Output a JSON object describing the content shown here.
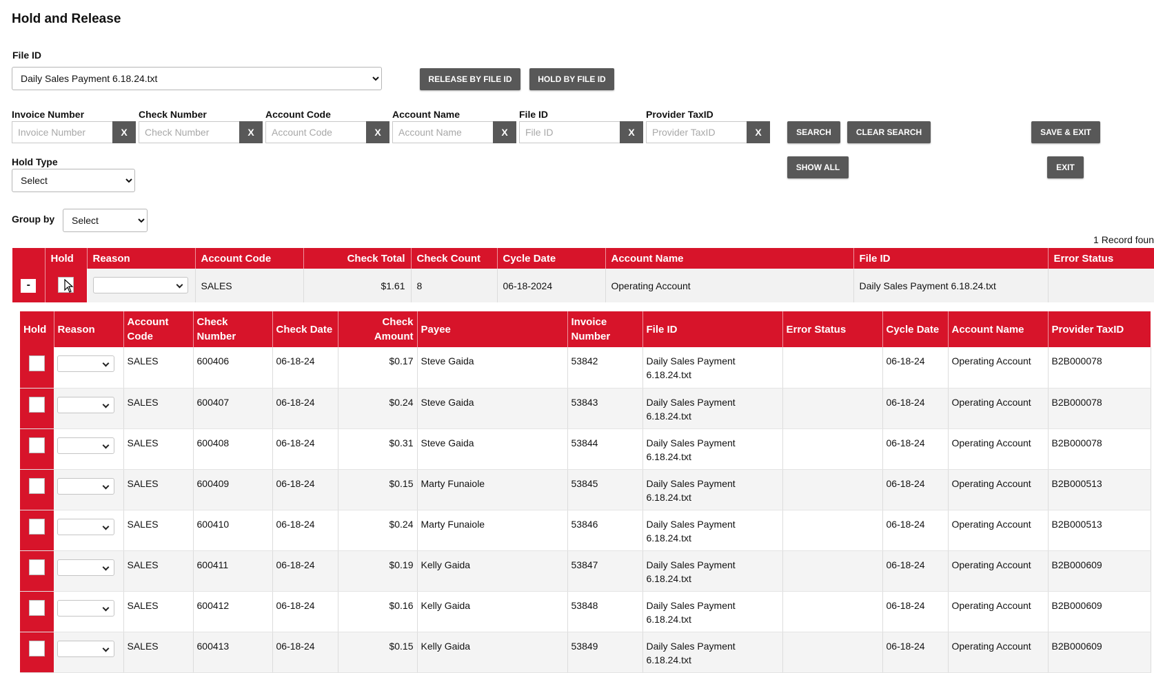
{
  "page": {
    "title": "Hold and Release"
  },
  "file_id_field": {
    "label": "File ID",
    "selected": "Daily Sales Payment 6.18.24.txt"
  },
  "buttons": {
    "release_by_file_id": "RELEASE BY FILE ID",
    "hold_by_file_id": "HOLD BY FILE ID",
    "search": "SEARCH",
    "clear_search": "CLEAR SEARCH",
    "save_exit": "SAVE & EXIT",
    "show_all": "SHOW ALL",
    "exit": "EXIT",
    "clear_x": "X",
    "collapse": "-"
  },
  "filters": [
    {
      "label": "Invoice Number",
      "placeholder": "Invoice Number",
      "value": ""
    },
    {
      "label": "Check Number",
      "placeholder": "Check Number",
      "value": ""
    },
    {
      "label": "Account Code",
      "placeholder": "Account Code",
      "value": ""
    },
    {
      "label": "Account Name",
      "placeholder": "Account Name",
      "value": ""
    },
    {
      "label": "File ID",
      "placeholder": "File ID",
      "value": ""
    },
    {
      "label": "Provider TaxID",
      "placeholder": "Provider TaxID",
      "value": ""
    }
  ],
  "hold_type": {
    "label": "Hold Type",
    "selected": "Select"
  },
  "group_by": {
    "label": "Group by",
    "selected": "Select"
  },
  "record_count": "1 Record foun",
  "group_table": {
    "headers": [
      "",
      "Hold",
      "Reason",
      "Account Code",
      "Check Total",
      "Check Count",
      "Cycle Date",
      "Account Name",
      "File ID",
      "Error Status"
    ],
    "row": {
      "account_code": "SALES",
      "check_total": "$1.61",
      "check_count": "8",
      "cycle_date": "06-18-2024",
      "account_name": "Operating Account",
      "file_id": "Daily Sales Payment 6.18.24.txt",
      "error_status": ""
    }
  },
  "detail_table": {
    "headers": {
      "hold": "Hold",
      "reason": "Reason",
      "account_code_1": "Account",
      "account_code_2": "Code",
      "check_number_1": "Check",
      "check_number_2": "Number",
      "check_date": "Check Date",
      "check_amount_1": "Check",
      "check_amount_2": "Amount",
      "payee": "Payee",
      "invoice_number_1": "Invoice",
      "invoice_number_2": "Number",
      "file_id": "File ID",
      "error_status": "Error Status",
      "cycle_date": "Cycle Date",
      "account_name": "Account Name",
      "provider_taxid": "Provider TaxID"
    },
    "rows": [
      {
        "account_code": "SALES",
        "check_number": "600406",
        "check_date": "06-18-24",
        "check_amount": "$0.17",
        "payee": "Steve Gaida",
        "invoice_number": "53842",
        "file_id_1": "Daily Sales Payment",
        "file_id_2": "6.18.24.txt",
        "error_status": "",
        "cycle_date": "06-18-24",
        "account_name": "Operating Account",
        "provider_taxid": "B2B000078"
      },
      {
        "account_code": "SALES",
        "check_number": "600407",
        "check_date": "06-18-24",
        "check_amount": "$0.24",
        "payee": "Steve Gaida",
        "invoice_number": "53843",
        "file_id_1": "Daily Sales Payment",
        "file_id_2": "6.18.24.txt",
        "error_status": "",
        "cycle_date": "06-18-24",
        "account_name": "Operating Account",
        "provider_taxid": "B2B000078"
      },
      {
        "account_code": "SALES",
        "check_number": "600408",
        "check_date": "06-18-24",
        "check_amount": "$0.31",
        "payee": "Steve Gaida",
        "invoice_number": "53844",
        "file_id_1": "Daily Sales Payment",
        "file_id_2": "6.18.24.txt",
        "error_status": "",
        "cycle_date": "06-18-24",
        "account_name": "Operating Account",
        "provider_taxid": "B2B000078"
      },
      {
        "account_code": "SALES",
        "check_number": "600409",
        "check_date": "06-18-24",
        "check_amount": "$0.15",
        "payee": "Marty Funaiole",
        "invoice_number": "53845",
        "file_id_1": "Daily Sales Payment",
        "file_id_2": "6.18.24.txt",
        "error_status": "",
        "cycle_date": "06-18-24",
        "account_name": "Operating Account",
        "provider_taxid": "B2B000513"
      },
      {
        "account_code": "SALES",
        "check_number": "600410",
        "check_date": "06-18-24",
        "check_amount": "$0.24",
        "payee": "Marty Funaiole",
        "invoice_number": "53846",
        "file_id_1": "Daily Sales Payment",
        "file_id_2": "6.18.24.txt",
        "error_status": "",
        "cycle_date": "06-18-24",
        "account_name": "Operating Account",
        "provider_taxid": "B2B000513"
      },
      {
        "account_code": "SALES",
        "check_number": "600411",
        "check_date": "06-18-24",
        "check_amount": "$0.19",
        "payee": "Kelly Gaida",
        "invoice_number": "53847",
        "file_id_1": "Daily Sales Payment",
        "file_id_2": "6.18.24.txt",
        "error_status": "",
        "cycle_date": "06-18-24",
        "account_name": "Operating Account",
        "provider_taxid": "B2B000609"
      },
      {
        "account_code": "SALES",
        "check_number": "600412",
        "check_date": "06-18-24",
        "check_amount": "$0.16",
        "payee": "Kelly Gaida",
        "invoice_number": "53848",
        "file_id_1": "Daily Sales Payment",
        "file_id_2": "6.18.24.txt",
        "error_status": "",
        "cycle_date": "06-18-24",
        "account_name": "Operating Account",
        "provider_taxid": "B2B000609"
      },
      {
        "account_code": "SALES",
        "check_number": "600413",
        "check_date": "06-18-24",
        "check_amount": "$0.15",
        "payee": "Kelly Gaida",
        "invoice_number": "53849",
        "file_id_1": "Daily Sales Payment",
        "file_id_2": "6.18.24.txt",
        "error_status": "",
        "cycle_date": "06-18-24",
        "account_name": "Operating Account",
        "provider_taxid": "B2B000609"
      }
    ]
  },
  "colors": {
    "header_red": "#d7142a",
    "button_gray": "#585858"
  }
}
